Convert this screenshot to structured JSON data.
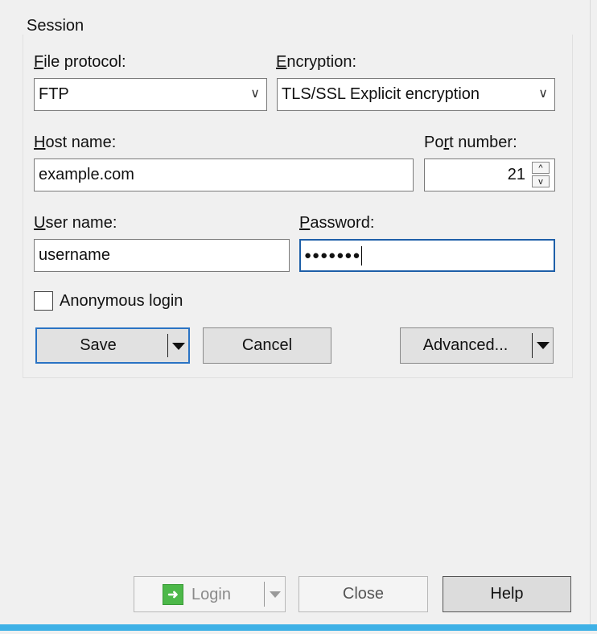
{
  "session": {
    "title": "Session"
  },
  "protocol": {
    "label": {
      "pre": "",
      "key": "F",
      "post": "ile protocol:"
    },
    "value": "FTP"
  },
  "encryption": {
    "label": {
      "pre": "",
      "key": "E",
      "post": "ncryption:"
    },
    "value": "TLS/SSL Explicit encryption"
  },
  "host": {
    "label": {
      "pre": "",
      "key": "H",
      "post": "ost name:"
    },
    "value": "example.com"
  },
  "port": {
    "label": {
      "pre": "Po",
      "key": "r",
      "post": "t number:"
    },
    "value": "21",
    "up": "^",
    "down": "v"
  },
  "user": {
    "label": {
      "pre": "",
      "key": "U",
      "post": "ser name:"
    },
    "value": "username"
  },
  "password": {
    "label": {
      "pre": "",
      "key": "P",
      "post": "assword:"
    },
    "value": "●●●●●●●"
  },
  "anonymous": {
    "label": "Anonymous login",
    "checked": false
  },
  "buttons": {
    "save": "Save",
    "cancel": "Cancel",
    "advanced": "Advanced...",
    "login": "Login",
    "close": "Close",
    "help": "Help"
  },
  "icons": {
    "login": "login-arrow-icon",
    "dropdown": "dropdown-arrow-icon"
  },
  "colors": {
    "accent": "#2a73c4",
    "login_icon": "#4cb849",
    "taskbar": "#3fb1e6"
  }
}
